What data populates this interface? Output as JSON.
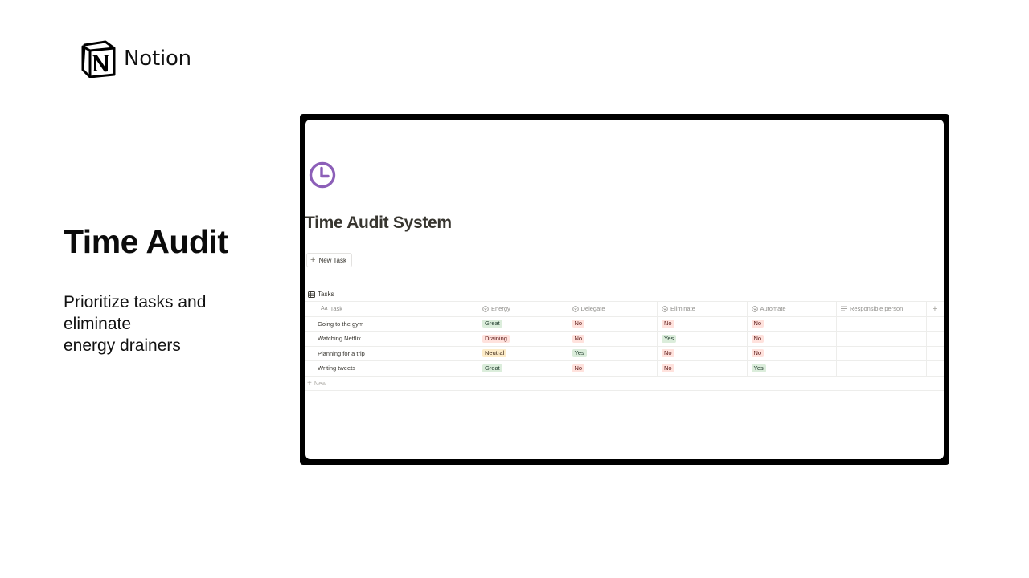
{
  "brand": {
    "name": "Notion",
    "logo_icon": "notion-logo-icon"
  },
  "hero": {
    "title": "Time Audit",
    "subtitle_lines": [
      "Prioritize tasks and",
      "eliminate",
      "energy drainers"
    ]
  },
  "page": {
    "icon": "clock-icon",
    "icon_color": "#8c5fb8",
    "title": "Time Audit System",
    "new_task_label": "New Task",
    "db_tab_label": "Tasks",
    "new_row_label": "New",
    "columns": [
      {
        "label": "Task",
        "icon": "text-type-icon",
        "icon_glyph": "Aa"
      },
      {
        "label": "Energy",
        "icon": "select-icon"
      },
      {
        "label": "Delegate",
        "icon": "select-icon"
      },
      {
        "label": "Eliminate",
        "icon": "select-icon"
      },
      {
        "label": "Automate",
        "icon": "select-icon"
      },
      {
        "label": "Responsible person",
        "icon": "text-lines-icon"
      }
    ],
    "rows": [
      {
        "task": "Going to the gym",
        "energy": "Great",
        "delegate": "No",
        "eliminate": "No",
        "automate": "No",
        "responsible": ""
      },
      {
        "task": "Watching Netflix",
        "energy": "Draining",
        "delegate": "No",
        "eliminate": "Yes",
        "automate": "No",
        "responsible": ""
      },
      {
        "task": "Planning for a trip",
        "energy": "Neutral",
        "delegate": "Yes",
        "eliminate": "No",
        "automate": "No",
        "responsible": ""
      },
      {
        "task": "Writing tweets",
        "energy": "Great",
        "delegate": "No",
        "eliminate": "No",
        "automate": "Yes",
        "responsible": ""
      }
    ],
    "tag_colors": {
      "Great": {
        "bg": "#dbeddb",
        "fg": "#1c3829"
      },
      "Draining": {
        "bg": "#ffe2dd",
        "fg": "#5d1715"
      },
      "Neutral": {
        "bg": "#fdecc8",
        "fg": "#402c1b"
      },
      "Yes": {
        "bg": "#dbeddb",
        "fg": "#1c3829"
      },
      "No": {
        "bg": "#ffe2dd",
        "fg": "#5d1715"
      }
    }
  }
}
